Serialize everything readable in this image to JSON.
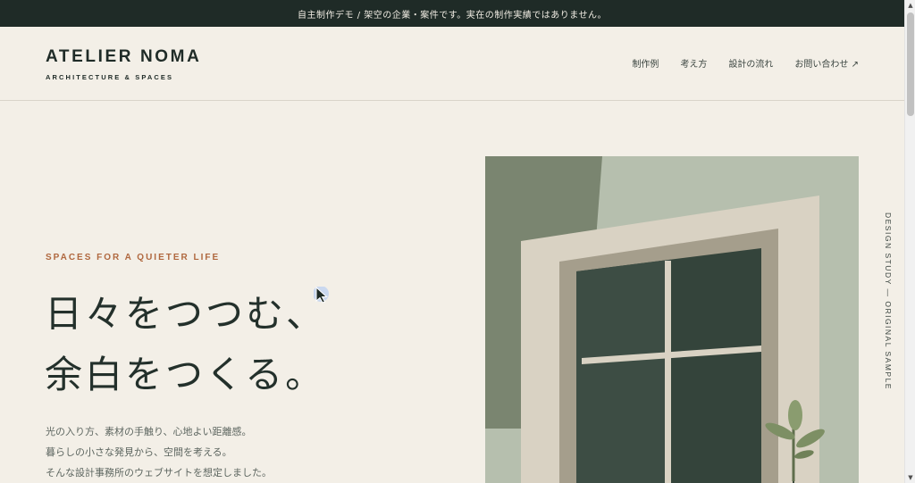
{
  "notice": "自主制作デモ / 架空の企業・案件です。実在の制作実績ではありません。",
  "brand": {
    "name": "ATELIER NOMA",
    "tagline": "ARCHITECTURE & SPACES"
  },
  "nav": [
    "制作例",
    "考え方",
    "設計の流れ",
    "お問い合わせ ↗"
  ],
  "hero": {
    "eyebrow": "SPACES FOR A QUIETER LIFE",
    "headline": [
      "日々をつつむ、",
      "余白をつくる。"
    ],
    "body": [
      "光の入り方、素材の手触り、心地よい距離感。",
      "暮らしの小さな発見から、空間を考える。",
      "そんな設計事務所のウェブサイトを想定しました。"
    ]
  },
  "side_label": "DESIGN STUDY — ORIGINAL SAMPLE",
  "colors": {
    "background": "#f3efe7",
    "dark": "#1f2b27",
    "accent": "#b0683f",
    "sage": "#7a8570",
    "sage_light": "#b6bfae",
    "frame": "#d9d2c3",
    "glass": "#34443b"
  },
  "icons": {
    "external_link": "arrow-up-right-icon",
    "cursor": "mouse-pointer-icon",
    "scroll_up": "triangle-up-icon",
    "scroll_down": "triangle-down-icon"
  }
}
